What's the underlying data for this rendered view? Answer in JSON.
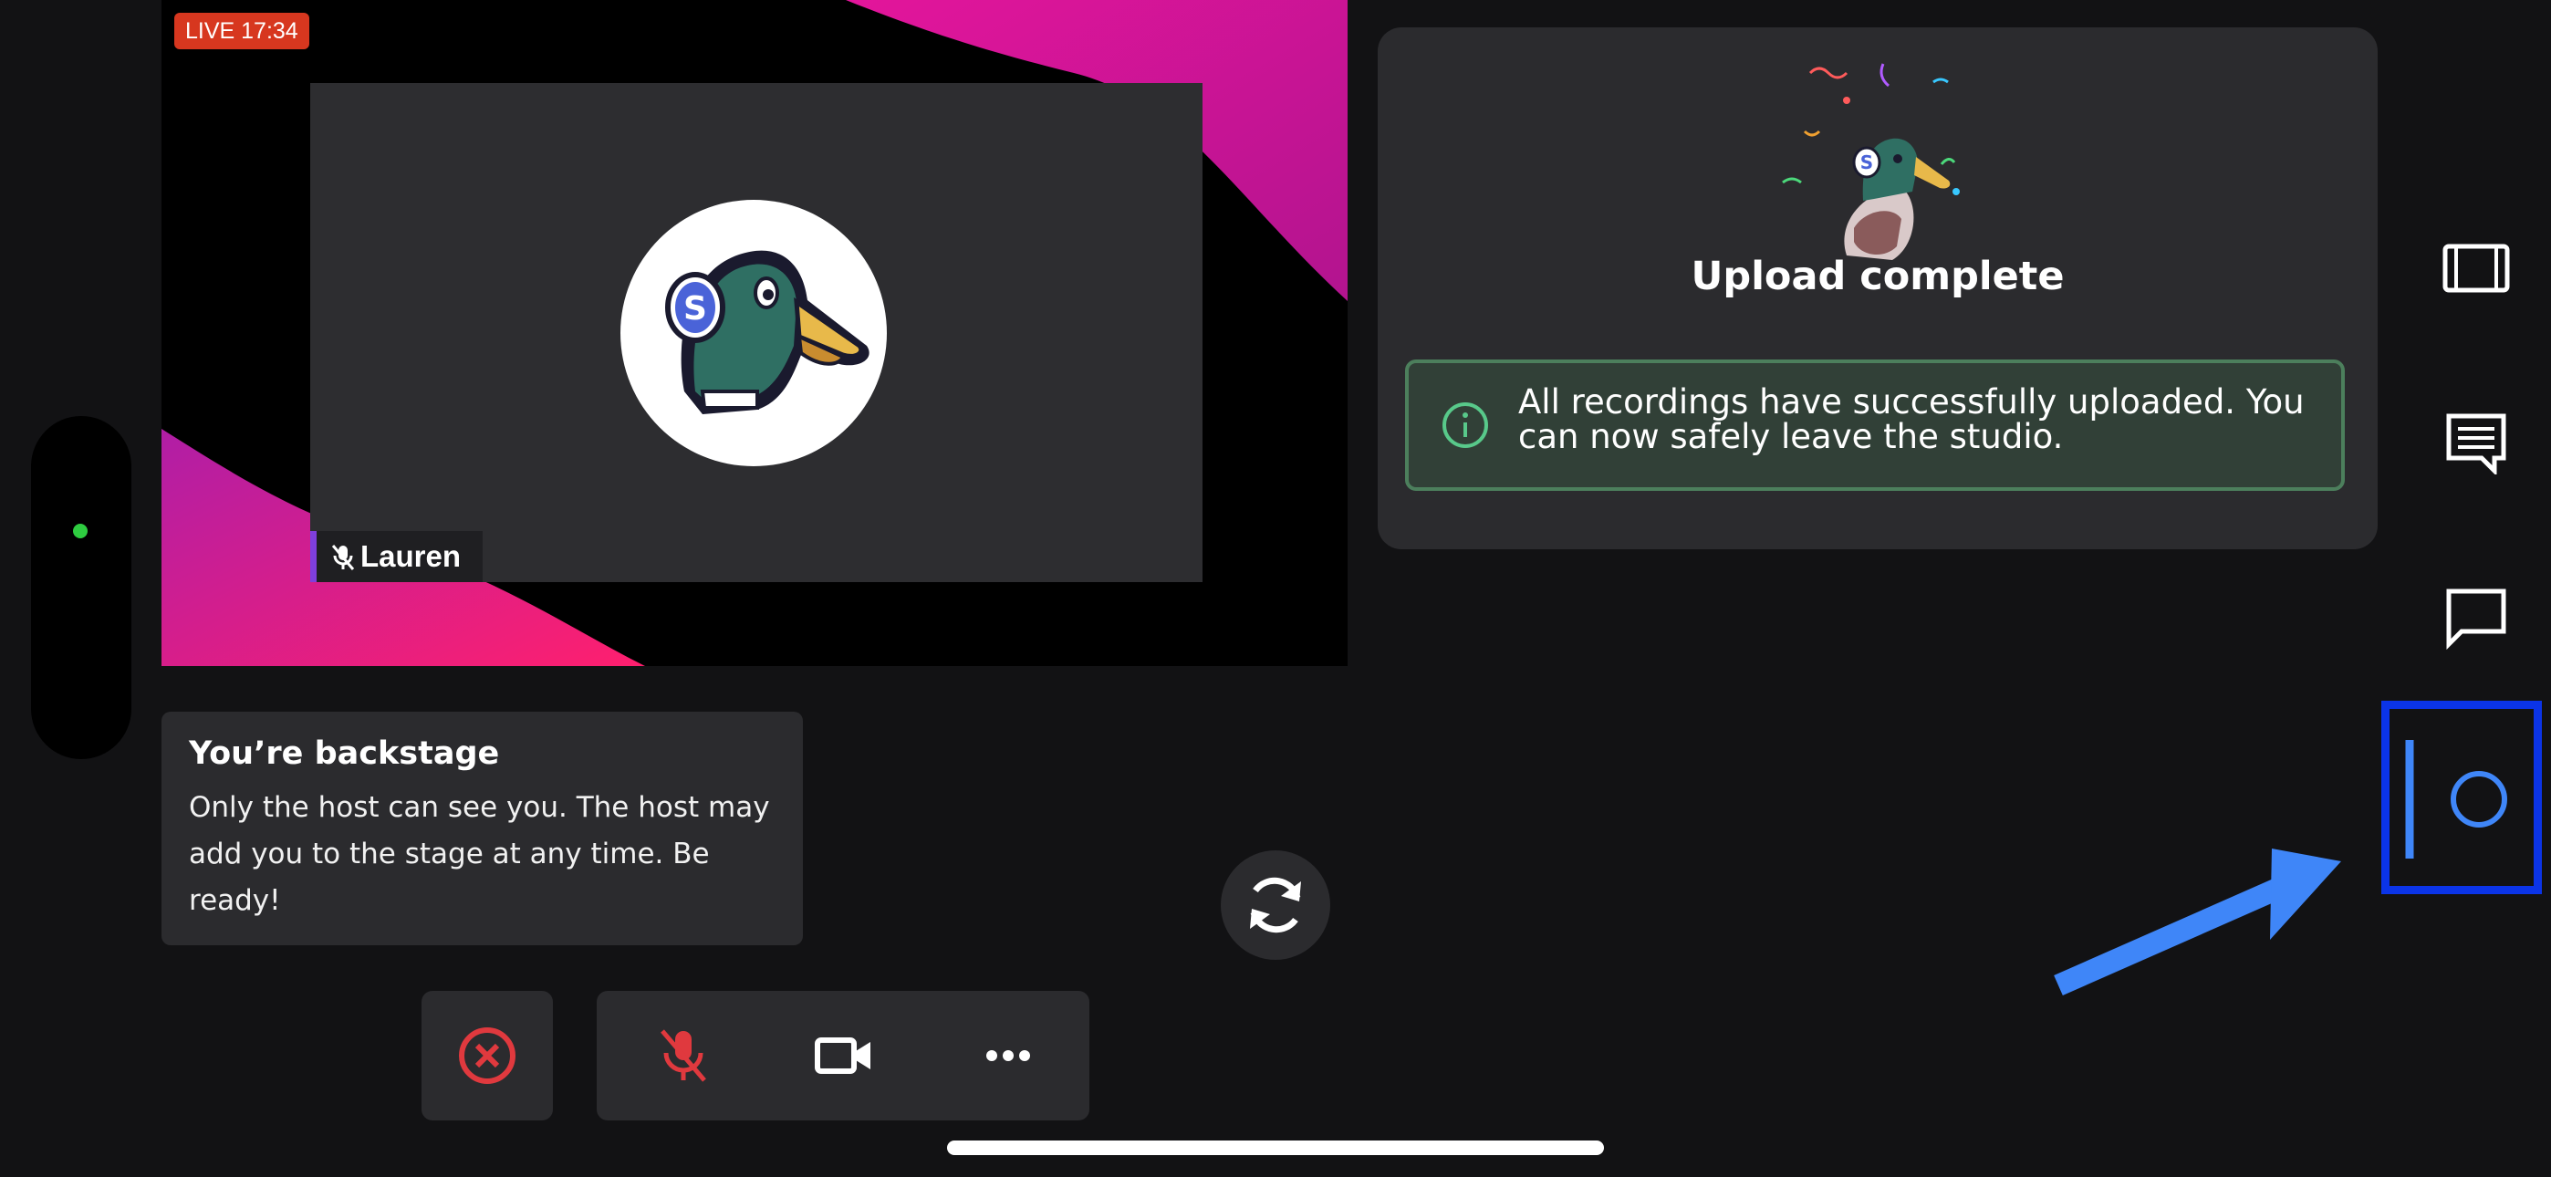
{
  "stage": {
    "live_label": "LIVE 17:34",
    "participant_name": "Lauren"
  },
  "backstage": {
    "title": "You’re backstage",
    "body": "Only the host can see you. The host may add you to the stage at any time. Be ready!"
  },
  "upload": {
    "title": "Upload complete",
    "message": "All recordings have successfully uploaded. You can now safely leave the studio."
  },
  "status": {
    "connection": "online"
  },
  "icons": {
    "leave": "close-circle-icon",
    "mic": "mic-off-icon",
    "camera": "video-camera-icon",
    "more": "more-horizontal-icon",
    "refresh": "refresh-icon",
    "side": [
      "layout-icon",
      "comments-icon",
      "chat-icon",
      "record-panel-icon"
    ]
  },
  "colors": {
    "live": "#d7371f",
    "accent": "#7f3fdc",
    "danger": "#e0393e",
    "success": "#4c7f5c",
    "highlight": "#0b34e8",
    "arrow": "#3f86f8"
  }
}
